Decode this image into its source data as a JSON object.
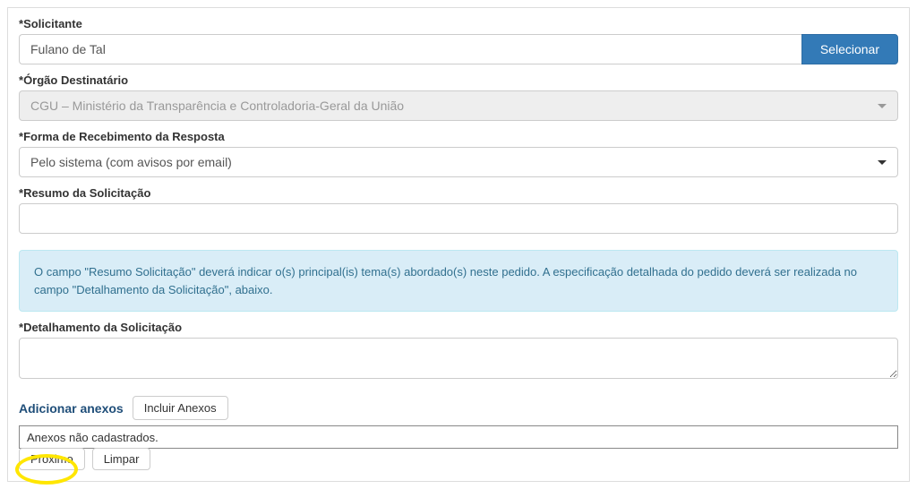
{
  "fields": {
    "solicitante": {
      "label": "Solicitante",
      "value": "Fulano de Tal",
      "button": "Selecionar"
    },
    "orgao": {
      "label": "Órgão Destinatário",
      "value": "CGU – Ministério da Transparência e Controladoria-Geral da União"
    },
    "forma": {
      "label": "Forma de Recebimento da Resposta",
      "value": "Pelo sistema (com avisos por email)"
    },
    "resumo": {
      "label": "Resumo da Solicitação"
    },
    "detalhamento": {
      "label": "Detalhamento da Solicitação"
    }
  },
  "info": "O campo \"Resumo Solicitação\" deverá indicar o(s) principal(is) tema(s) abordado(s) neste pedido. A especificação detalhada do pedido deverá ser realizada no campo \"Detalhamento da Solicitação\", abaixo.",
  "anexos": {
    "title": "Adicionar anexos",
    "button": "Incluir Anexos",
    "empty": "Anexos não cadastrados."
  },
  "actions": {
    "next": "Próximo",
    "clear": "Limpar"
  }
}
